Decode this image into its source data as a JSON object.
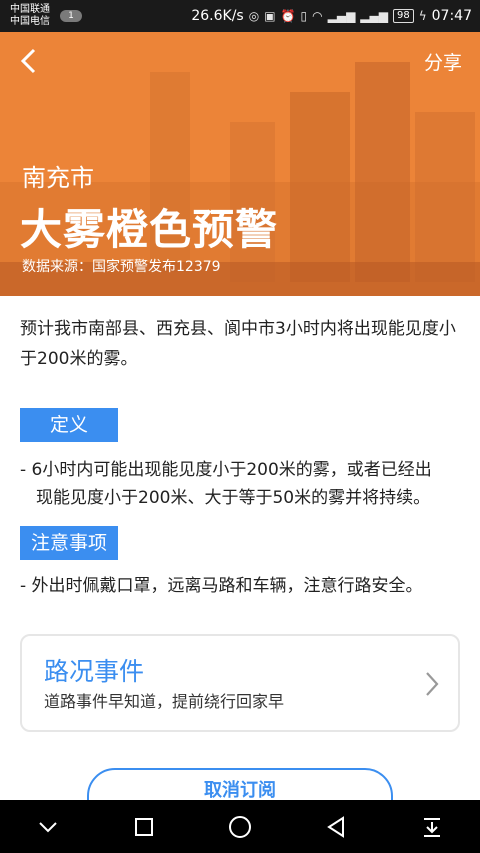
{
  "status_bar": {
    "carrier_1": "中国联通",
    "carrier_2": "中国电信",
    "notification_count": "1",
    "speed": "26.6K/s",
    "battery": "98",
    "time": "07:47"
  },
  "header": {
    "share_label": "分享",
    "city": "南充市",
    "alert_title": "大雾橙色预警",
    "source": "数据来源：国家预警发布12379"
  },
  "summary": "预计我市南部县、西充县、阆中市3小时内将出现能见度小于200米的雾。",
  "definition": {
    "label": "定义",
    "line_1": "- 6小时内可能出现能见度小于200米的雾，或者已经出",
    "line_2": "现能见度小于200米、大于等于50米的雾并将持续。"
  },
  "notes": {
    "label": "注意事项",
    "text": "- 外出时佩戴口罩，远离马路和车辆，注意行路安全。"
  },
  "road_card": {
    "title": "路况事件",
    "subtitle": "道路事件早知道，提前绕行回家早"
  },
  "unsubscribe_label": "取消订阅",
  "colors": {
    "accent": "#3b8ef0",
    "hero_orange": "#e87f34"
  }
}
